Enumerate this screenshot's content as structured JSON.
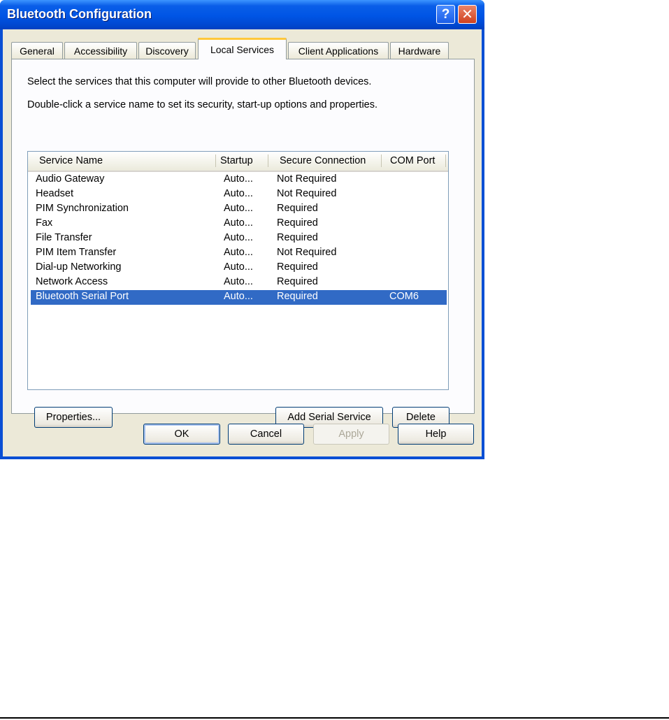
{
  "window": {
    "title": "Bluetooth Configuration"
  },
  "tabs": [
    {
      "label": "General"
    },
    {
      "label": "Accessibility"
    },
    {
      "label": "Discovery"
    },
    {
      "label": "Local Services",
      "active": true
    },
    {
      "label": "Client Applications"
    },
    {
      "label": "Hardware"
    }
  ],
  "panel": {
    "description1": "Select the services that this computer will provide to other Bluetooth devices.",
    "description2": "Double-click a service name to set its security, start-up options and properties."
  },
  "listview": {
    "columns": [
      "Service Name",
      "Startup",
      "Secure Connection",
      "COM Port"
    ],
    "rows": [
      {
        "name": "Audio Gateway",
        "startup": "Auto...",
        "secure": "Not Required",
        "com": ""
      },
      {
        "name": "Headset",
        "startup": "Auto...",
        "secure": "Not Required",
        "com": ""
      },
      {
        "name": "PIM Synchronization",
        "startup": "Auto...",
        "secure": "Required",
        "com": ""
      },
      {
        "name": "Fax",
        "startup": "Auto...",
        "secure": "Required",
        "com": ""
      },
      {
        "name": "File Transfer",
        "startup": "Auto...",
        "secure": "Required",
        "com": ""
      },
      {
        "name": "PIM Item Transfer",
        "startup": "Auto...",
        "secure": "Not Required",
        "com": ""
      },
      {
        "name": "Dial-up Networking",
        "startup": "Auto...",
        "secure": "Required",
        "com": ""
      },
      {
        "name": "Network Access",
        "startup": "Auto...",
        "secure": "Required",
        "com": ""
      },
      {
        "name": "Bluetooth Serial Port",
        "startup": "Auto...",
        "secure": "Required",
        "com": "COM6",
        "selected": true
      }
    ]
  },
  "buttons": {
    "properties": "Properties...",
    "add_serial": "Add Serial Service",
    "delete": "Delete",
    "ok": "OK",
    "cancel": "Cancel",
    "apply": "Apply",
    "help": "Help"
  },
  "colors": {
    "titlebar": "#0055e5",
    "selection": "#316ac5",
    "dialog_bg": "#ece9d8",
    "active_tab_accent": "#ffc83c"
  }
}
